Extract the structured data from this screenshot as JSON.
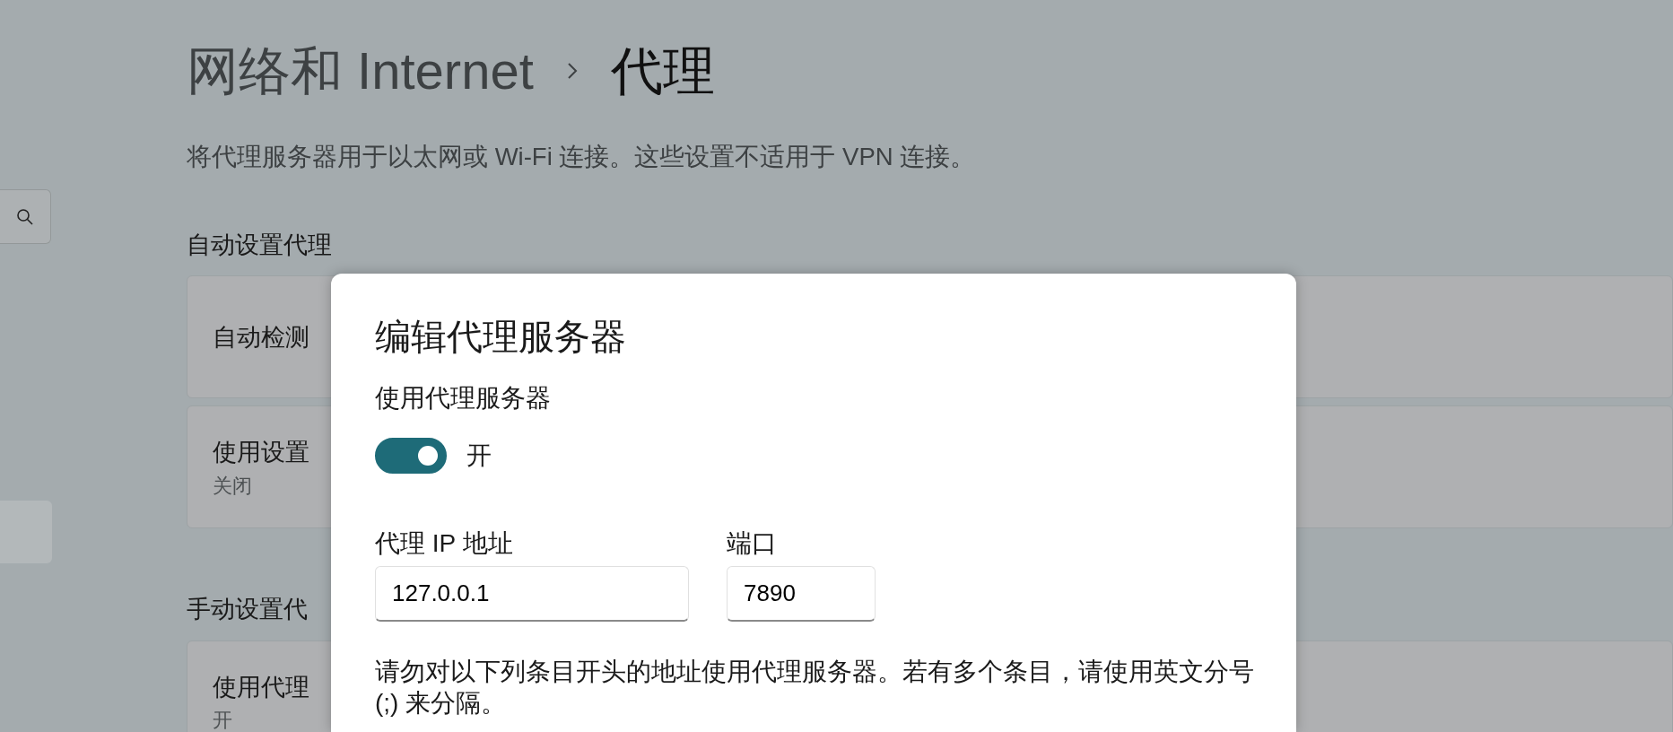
{
  "sidebar": {
    "items": [
      {
        "selected": true
      }
    ]
  },
  "page": {
    "breadcrumb": [
      {
        "label": "网络和 Internet",
        "current": false
      },
      {
        "label": "代理",
        "current": true
      }
    ],
    "description": "将代理服务器用于以太网或 Wi-Fi 连接。这些设置不适用于 VPN 连接。",
    "sections": [
      {
        "heading": "自动设置代理",
        "cards": [
          {
            "title": "自动检测"
          },
          {
            "title": "使用设置",
            "subtitle": "关闭"
          }
        ]
      },
      {
        "heading": "手动设置代",
        "cards": [
          {
            "title": "使用代理",
            "subtitle": "开"
          }
        ]
      }
    ]
  },
  "dialog": {
    "title": "编辑代理服务器",
    "toggle": {
      "label": "使用代理服务器",
      "on": true,
      "state_text": "开"
    },
    "fields": [
      {
        "label": "代理 IP 地址",
        "value": "127.0.0.1"
      },
      {
        "label": "端口",
        "value": "7890"
      }
    ],
    "note": "请勿对以下列条目开头的地址使用代理服务器。若有多个条目，请使用英文分号 (;) 来分隔。"
  }
}
